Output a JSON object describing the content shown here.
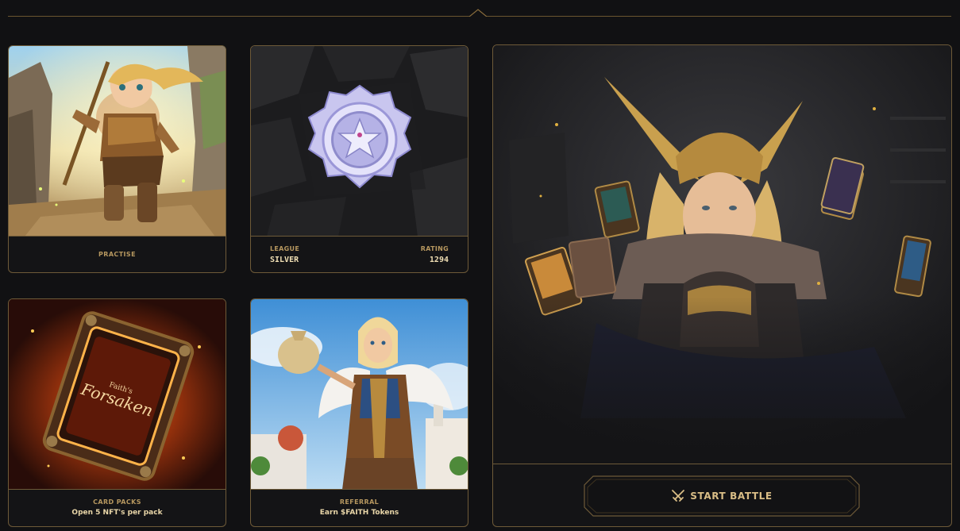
{
  "cards": {
    "practise": {
      "title": "PRACTISE"
    },
    "league": {
      "league_label": "LEAGUE",
      "league_value": "SILVER",
      "rating_label": "RATING",
      "rating_value": "1294"
    },
    "card_packs": {
      "title": "CARD PACKS",
      "subtitle": "Open 5 NFT's per pack",
      "book_text_small": "Faith's",
      "book_text": "Forsaken"
    },
    "referral": {
      "title": "REFERRAL",
      "subtitle": "Earn $FAITH Tokens"
    }
  },
  "battle": {
    "button_label": "START BATTLE"
  },
  "colors": {
    "accent_gold": "#c9a76a",
    "border_gold": "#6e5a38",
    "background": "#111113"
  },
  "icons": [
    "swords-icon",
    "silver-league-badge-icon"
  ]
}
